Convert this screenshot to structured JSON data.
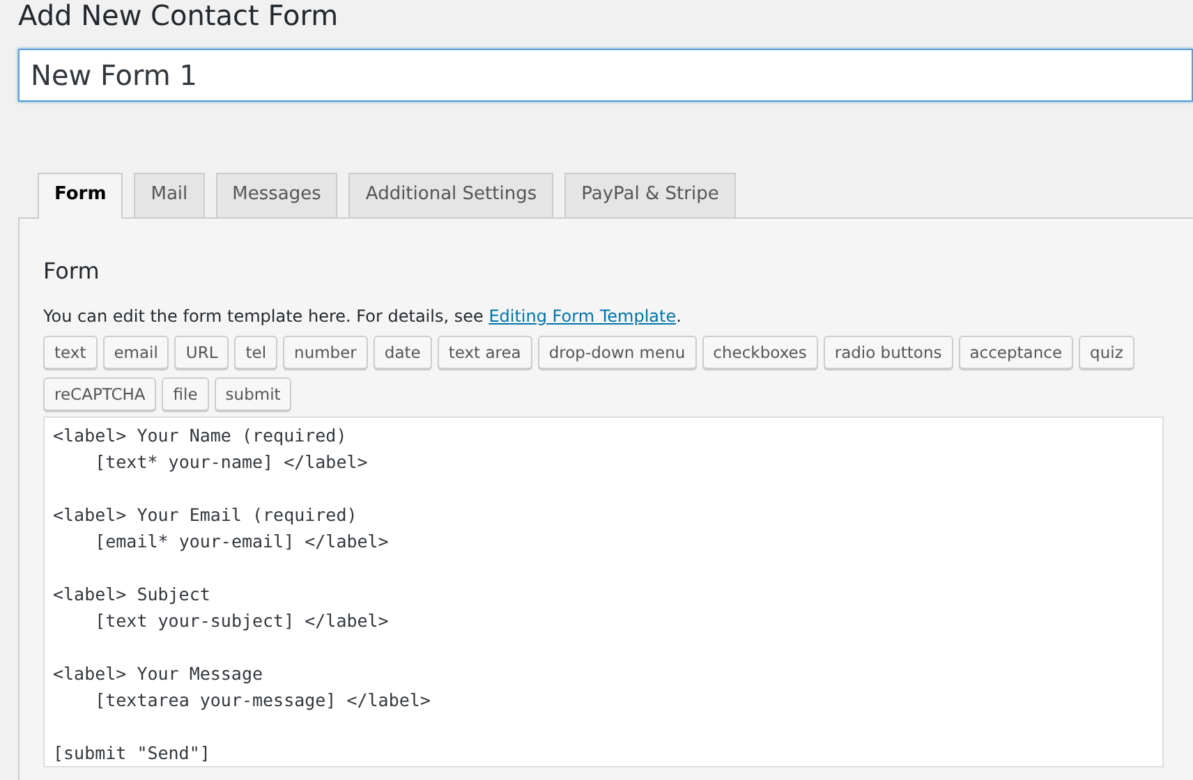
{
  "page_title": "Add New Contact Form",
  "form_title": {
    "value": "New Form 1"
  },
  "tabs": [
    {
      "label": "Form",
      "selected": true
    },
    {
      "label": "Mail",
      "selected": false
    },
    {
      "label": "Messages",
      "selected": false
    },
    {
      "label": "Additional Settings",
      "selected": false
    },
    {
      "label": "PayPal & Stripe",
      "selected": false
    }
  ],
  "panel": {
    "heading": "Form",
    "description": "You can edit the form template here. For details, see ",
    "link": "Editing Form Template",
    "description_end": ".",
    "tag_buttons": [
      "text",
      "email",
      "URL",
      "tel",
      "number",
      "date",
      "text area",
      "drop-down menu",
      "checkboxes",
      "radio buttons",
      "acceptance",
      "quiz",
      "reCAPTCHA",
      "file",
      "submit"
    ],
    "template": "<label> Your Name (required)\n    [text* your-name] </label>\n\n<label> Your Email (required)\n    [email* your-email] </label>\n\n<label> Subject\n    [text your-subject] </label>\n\n<label> Your Message\n    [textarea your-message] </label>\n\n[submit \"Send\"]"
  }
}
